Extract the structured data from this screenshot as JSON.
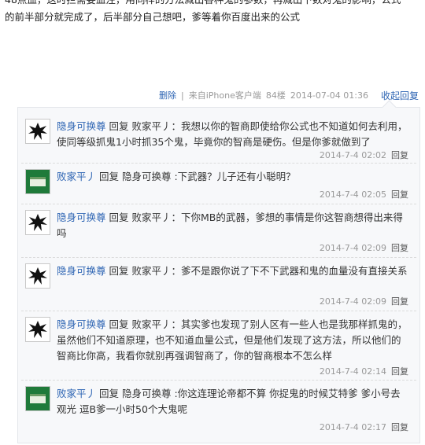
{
  "post": {
    "line1": "48点血，这时拦需要血注，用同样的方法减出各种鬼的参数，再减出下数对鬼的影响，公式",
    "line2": "的前半部分就完成了，后半部分自己想吧，爹等着你百度出来的公式"
  },
  "post_meta": {
    "delete": "删除",
    "source": "来自iPhone客户端",
    "floor": "84楼",
    "time": "2014-07-04 01:36",
    "collapse_reply": "收起回复"
  },
  "replies": [
    {
      "user": "隐身可换尊",
      "avatar": "phoenix",
      "text": "回复 败家平丿：我想以你的智商即使给你公式也不知道如何去利用，使同等级抓鬼1小时抓35个鬼，毕竟你的智商是硬伤。但是你爹就做到了",
      "time": "2014-7-4 02:02",
      "reply": "回复"
    },
    {
      "user": "败家平丿",
      "avatar": "green",
      "text": "回复 隐身可换尊 :下武器？儿子还有小聪明？",
      "time": "2014-7-4 02:05",
      "reply": "回复"
    },
    {
      "user": "隐身可换尊",
      "avatar": "phoenix",
      "text": "回复 败家平丿：下你MB的武器，爹想的事情是你这智商想得出来得吗",
      "time": "2014-7-4 02:09",
      "reply": "回复"
    },
    {
      "user": "隐身可换尊",
      "avatar": "phoenix",
      "text": "回复 败家平丿：爹不是跟你说了下不下武器和鬼的血量没有直接关系",
      "time": "2014-7-4 02:09",
      "reply": "回复"
    },
    {
      "user": "隐身可换尊",
      "avatar": "phoenix",
      "text": "回复 败家平丿：其实爹也发现了别人区有一些人也是我那样抓鬼的，虽然他们不知道原理，也不知道血量公式，但是他们发现了这方法，所以他们的智商比你高，我看你就别再强调智商了，你的智商根本不怎么样",
      "time": "2014-7-4 02:14",
      "reply": "回复"
    },
    {
      "user": "败家平丿",
      "avatar": "green",
      "text": "回复 隐身可换尊 :你这连理论帝都不算 你捉鬼的时候艾特爹 爹小号去观光 逗B爹一小时50个大鬼呢",
      "time": "2014-7-4 02:17",
      "reply": "回复"
    }
  ],
  "colors": {
    "link": "#2d64b3",
    "meta": "#999999",
    "panel_bg": "#f7f8fa",
    "green_avatar": "#1f7a3a"
  }
}
